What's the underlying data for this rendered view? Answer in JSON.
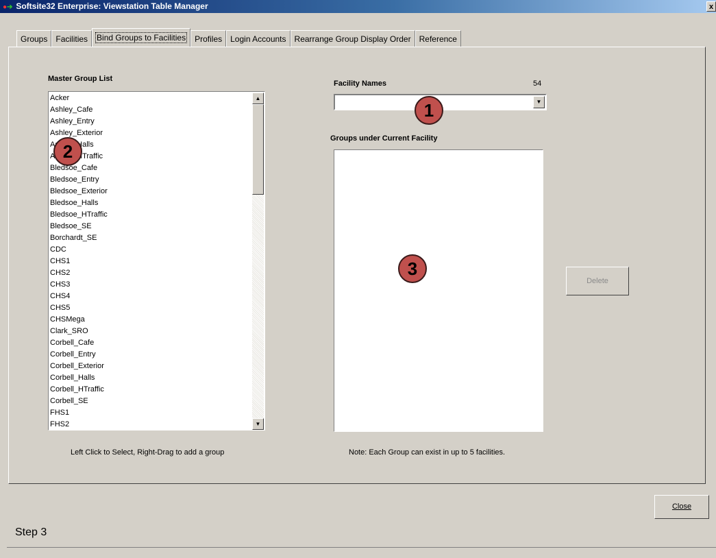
{
  "window": {
    "title": "Softsite32 Enterprise: Viewstation Table Manager",
    "close_glyph": "x"
  },
  "tabs": [
    {
      "label": "Groups"
    },
    {
      "label": "Facilities"
    },
    {
      "label": "Bind Groups to Facilities"
    },
    {
      "label": "Profiles"
    },
    {
      "label": "Login Accounts"
    },
    {
      "label": "Rearrange Group Display Order"
    },
    {
      "label": "Reference"
    }
  ],
  "master": {
    "heading": "Master Group List",
    "items": [
      "Acker",
      "Ashley_Cafe",
      "Ashley_Entry",
      "Ashley_Exterior",
      "Ashley_Halls",
      "Ashley_HTraffic",
      "Bledsoe_Cafe",
      "Bledsoe_Entry",
      "Bledsoe_Exterior",
      "Bledsoe_Halls",
      "Bledsoe_HTraffic",
      "Bledsoe_SE",
      "Borchardt_SE",
      "CDC",
      "CHS1",
      "CHS2",
      "CHS3",
      "CHS4",
      "CHS5",
      "CHSMega",
      "Clark_SRO",
      "Corbell_Cafe",
      "Corbell_Entry",
      "Corbell_Exterior",
      "Corbell_Halls",
      "Corbell_HTraffic",
      "Corbell_SE",
      "FHS1",
      "FHS2"
    ],
    "hint": "Left Click to Select, Right-Drag to add a group"
  },
  "facility": {
    "heading": "Facility Names",
    "count": "54",
    "selected_value": ""
  },
  "groups": {
    "heading": "Groups under Current Facility",
    "note": "Note: Each Group can exist in up to 5 facilities."
  },
  "buttons": {
    "delete": "Delete",
    "close": "Close"
  },
  "badges": {
    "one": "1",
    "two": "2",
    "three": "3"
  },
  "footer": {
    "step": "Step 3"
  },
  "colors": {
    "badge": "#c0504d",
    "window_bg": "#d4d0c8",
    "titlebar": "#0a246a"
  }
}
